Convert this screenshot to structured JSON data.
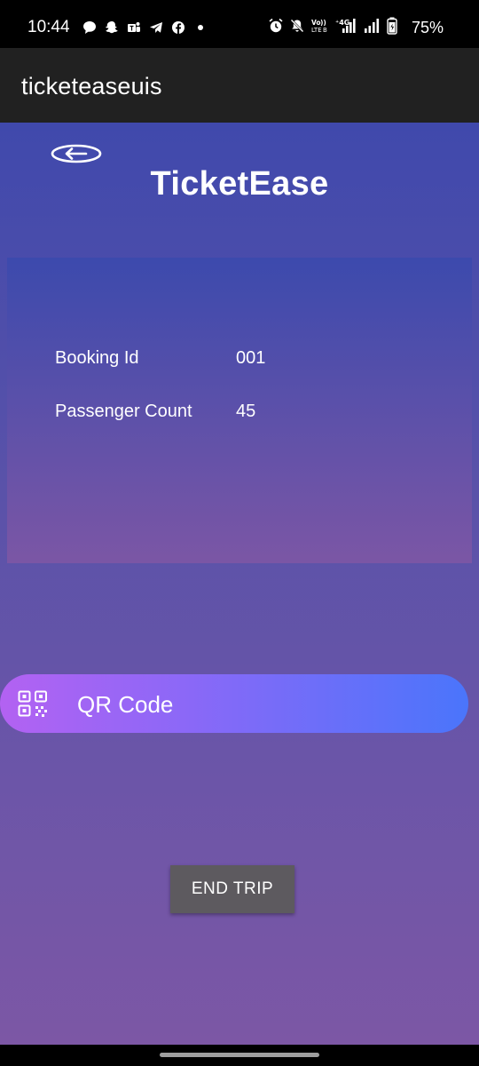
{
  "status_bar": {
    "time": "10:44",
    "battery": "75%",
    "left_icons": [
      "chat-icon",
      "snapchat-icon",
      "teams-icon",
      "telegram-icon",
      "facebook-icon",
      "dot-icon"
    ],
    "right_icons": [
      "alarm-icon",
      "mute-icon",
      "volte-icon",
      "signal-4g-icon",
      "signal-icon",
      "battery-icon"
    ]
  },
  "app_bar": {
    "title": "ticketeaseuis"
  },
  "header": {
    "brand": "TicketEase"
  },
  "booking": {
    "booking_id_label": "Booking Id",
    "booking_id_value": "001",
    "passenger_count_label": "Passenger Count",
    "passenger_count_value": "45"
  },
  "qr_button": {
    "label": "QR Code"
  },
  "end_trip_button": {
    "label": "END TRIP"
  },
  "colors": {
    "app_bar": "#212121",
    "background_top": "#4049ac",
    "background_bottom": "#7c57a5",
    "qr_gradient_start": "#b362f2",
    "qr_gradient_end": "#4a75fb",
    "end_trip_bg": "#5d5a5f"
  }
}
